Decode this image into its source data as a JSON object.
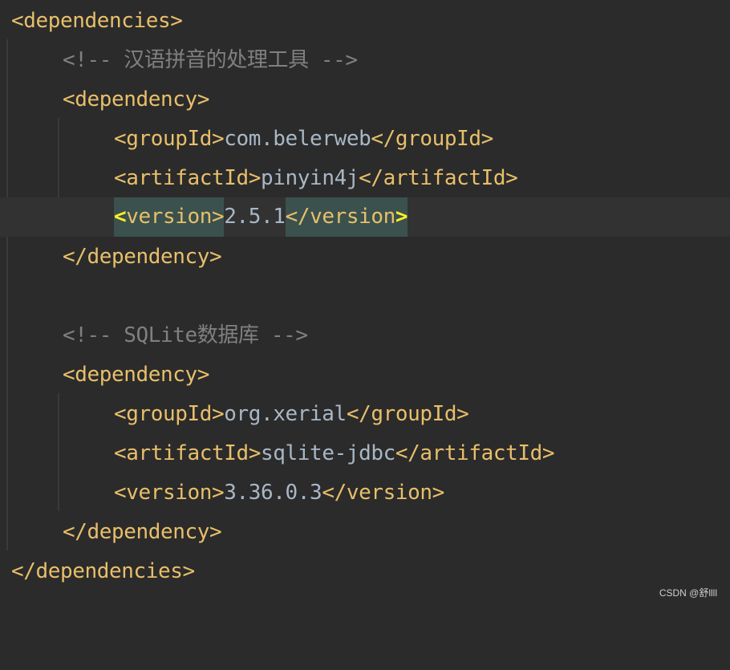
{
  "lines": [
    {
      "open": "<dependencies>"
    },
    {
      "comment": "<!-- 汉语拼音的处理工具 -->"
    },
    {
      "open": "<dependency>"
    },
    {
      "open": "<groupId>",
      "value": "com.belerweb",
      "close": "</groupId>"
    },
    {
      "open": "<artifactId>",
      "value": "pinyin4j",
      "close": "</artifactId>"
    },
    {
      "open_start": "<",
      "open_rest": "version>",
      "value": "2.5.1",
      "close_rest": "</version",
      "close_end": ">"
    },
    {
      "close": "</dependency>"
    },
    {
      "blank": ""
    },
    {
      "comment": "<!-- SQLite数据库 -->"
    },
    {
      "open": "<dependency>"
    },
    {
      "open": "<groupId>",
      "value": "org.xerial",
      "close": "</groupId>"
    },
    {
      "open": "<artifactId>",
      "value": "sqlite-jdbc",
      "close": "</artifactId>"
    },
    {
      "open": "<version>",
      "value": "3.36.0.3",
      "close": "</version>"
    },
    {
      "close": "</dependency>"
    },
    {
      "close": "</dependencies>"
    }
  ],
  "watermark": "CSDN @舒llll",
  "colors": {
    "background": "#2b2b2b",
    "tag": "#e8bf6a",
    "text": "#a9b7c6",
    "comment": "#808080",
    "match_highlight": "#3b514d",
    "current_line": "#323232"
  }
}
